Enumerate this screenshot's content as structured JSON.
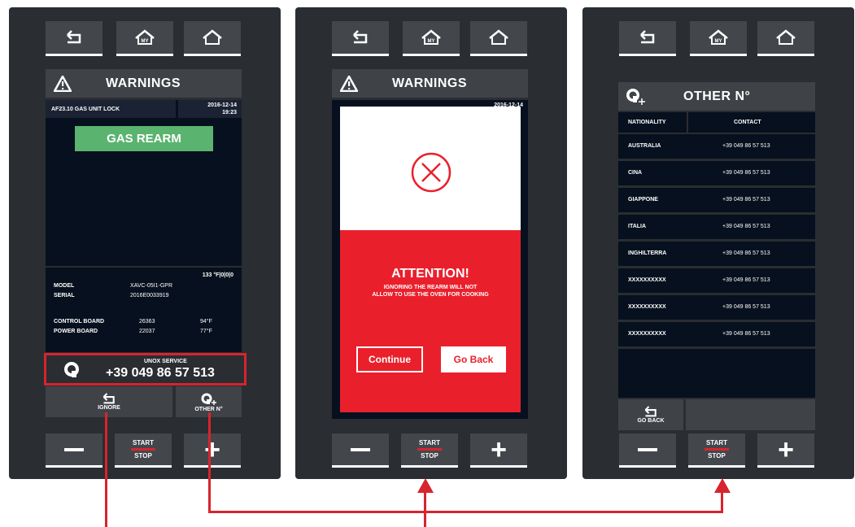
{
  "panel1": {
    "header_title": "WARNINGS",
    "alarm_code": "AF23.10 GAS UNIT LOCK",
    "alarm_date": "2016-12-14",
    "alarm_time": "19:23",
    "gas_rearm_label": "GAS REARM",
    "temp_status": "133 °F|0|0|0",
    "model_label": "MODEL",
    "model_value": "XAVC-05I1-GPR",
    "serial_label": "SERIAL",
    "serial_value": "2016E0033919",
    "control_board_label": "CONTROL BOARD",
    "control_board_value": "26363",
    "control_board_temp": "94°F",
    "power_board_label": "POWER BOARD",
    "power_board_value": "22037",
    "power_board_temp": "77°F",
    "service_label": "UNOX SERVICE",
    "service_phone": "+39 049 86 57 513",
    "ignore_label": "IGNORE",
    "other_label": "OTHER N°"
  },
  "panel2": {
    "header_title": "WARNINGS",
    "date_fragment": "2016-12-14",
    "attention_title": "ATTENTION!",
    "attention_line1": "IGNORING THE REARM WILL NOT",
    "attention_line2": "ALLOW TO USE THE OVEN FOR COOKING",
    "continue_label": "Continue",
    "goback_label": "Go Back"
  },
  "panel3": {
    "header_title": "OTHER N°",
    "col_nationality": "NATIONALITY",
    "col_contact": "CONTACT",
    "rows": [
      {
        "nationality": "AUSTRALIA",
        "contact": "+39 049 86 57 513"
      },
      {
        "nationality": "CINA",
        "contact": "+39 049 86 57 513"
      },
      {
        "nationality": "GIAPPONE",
        "contact": "+39 049 86 57 513"
      },
      {
        "nationality": "ITALIA",
        "contact": "+39 049 86 57 513"
      },
      {
        "nationality": "INGHILTERRA",
        "contact": "+39 049 86 57 513"
      },
      {
        "nationality": "XXXXXXXXXX",
        "contact": "+39 049 86 57 513"
      },
      {
        "nationality": "XXXXXXXXXX",
        "contact": "+39 049 86 57 513"
      },
      {
        "nationality": "XXXXXXXXXX",
        "contact": "+39 049 86 57 513"
      }
    ],
    "goback_label": "GO BACK"
  },
  "common": {
    "my_badge": "MY",
    "start_label": "START",
    "stop_label": "STOP"
  },
  "colors": {
    "panel_bg": "#2a2d31",
    "button_bg": "#43474c",
    "screen_bg": "#07101e",
    "accent_red": "#d7242e",
    "rearm_green": "#5ab36e",
    "overlay_red": "#e9202c"
  }
}
